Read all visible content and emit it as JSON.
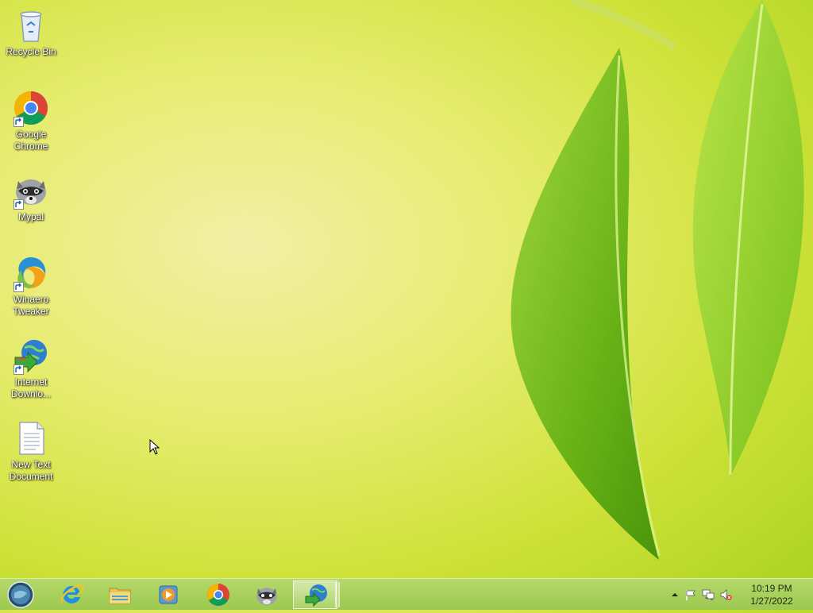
{
  "desktop": {
    "icons": [
      {
        "label": "Recycle Bin",
        "icon": "recycle-bin-icon",
        "shortcut": false
      },
      {
        "label": "Google Chrome",
        "icon": "chrome-icon",
        "shortcut": true
      },
      {
        "label": "Mypal",
        "icon": "mypal-raccoon-icon",
        "shortcut": true
      },
      {
        "label": "Winaero Tweaker",
        "icon": "winaero-tweaker-icon",
        "shortcut": true
      },
      {
        "label": "Internet Downlo...",
        "icon": "internet-download-manager-icon",
        "shortcut": true
      },
      {
        "label": "New Text Document",
        "icon": "text-document-icon",
        "shortcut": false
      }
    ]
  },
  "taskbar": {
    "start": {
      "icon": "start-orb-icon"
    },
    "pinned": [
      {
        "name": "internet-explorer",
        "icon": "internet-explorer-icon",
        "active": false
      },
      {
        "name": "file-explorer",
        "icon": "folder-icon",
        "active": false
      },
      {
        "name": "media-player",
        "icon": "media-player-icon",
        "active": false
      },
      {
        "name": "google-chrome",
        "icon": "chrome-icon",
        "active": false
      },
      {
        "name": "mypal",
        "icon": "mypal-raccoon-icon",
        "active": false
      },
      {
        "name": "internet-download-manager",
        "icon": "internet-download-manager-icon",
        "active": true
      }
    ],
    "tray": {
      "icons": [
        "show-hidden-icons-icon",
        "action-center-flag-icon",
        "network-icon",
        "volume-muted-icon"
      ],
      "time": "10:19 PM",
      "date": "1/27/2022"
    }
  },
  "colors": {
    "wallpaper_light": "#f2f0a6",
    "wallpaper_green": "#a9d21e",
    "leaf": "#6fb51c",
    "taskbar": "#a6cf5a"
  }
}
